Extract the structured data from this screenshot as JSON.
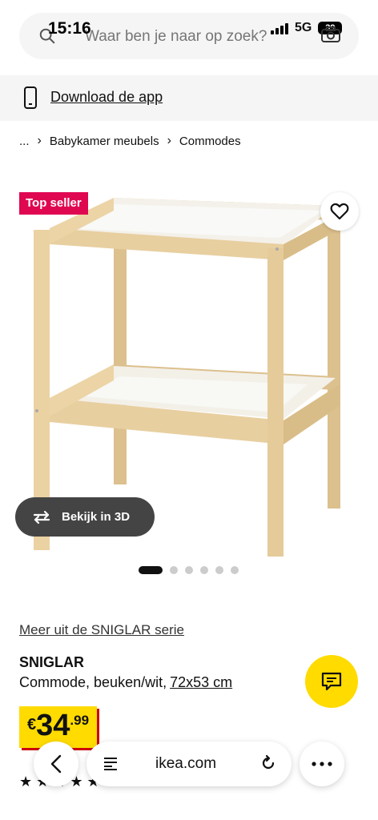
{
  "status_bar": {
    "time": "15:16",
    "network": "5G",
    "battery": "39"
  },
  "search": {
    "placeholder": "Waar ben je naar op zoek?"
  },
  "download_bar": {
    "label": "Download de app"
  },
  "breadcrumb": {
    "items": [
      "...",
      "Babykamer meubels",
      "Commodes"
    ]
  },
  "product": {
    "badge": "Top seller",
    "view_3d_label": "Bekijk in 3D",
    "carousel": {
      "total": 6,
      "active_index": 0
    },
    "series_link": "Meer uit de SNIGLAR serie",
    "name": "SNIGLAR",
    "description": "Commode, beuken/wit,",
    "size": "72x53 cm",
    "price": {
      "currency": "€",
      "main": "34",
      "decimals": ".99"
    },
    "rating_stars": "★ ★ ★ ★ ★"
  },
  "browser": {
    "url": "ikea.com"
  },
  "colors": {
    "ikea_yellow": "#ffdb00",
    "badge_red": "#e00751",
    "wood": "#e8cfa0"
  }
}
